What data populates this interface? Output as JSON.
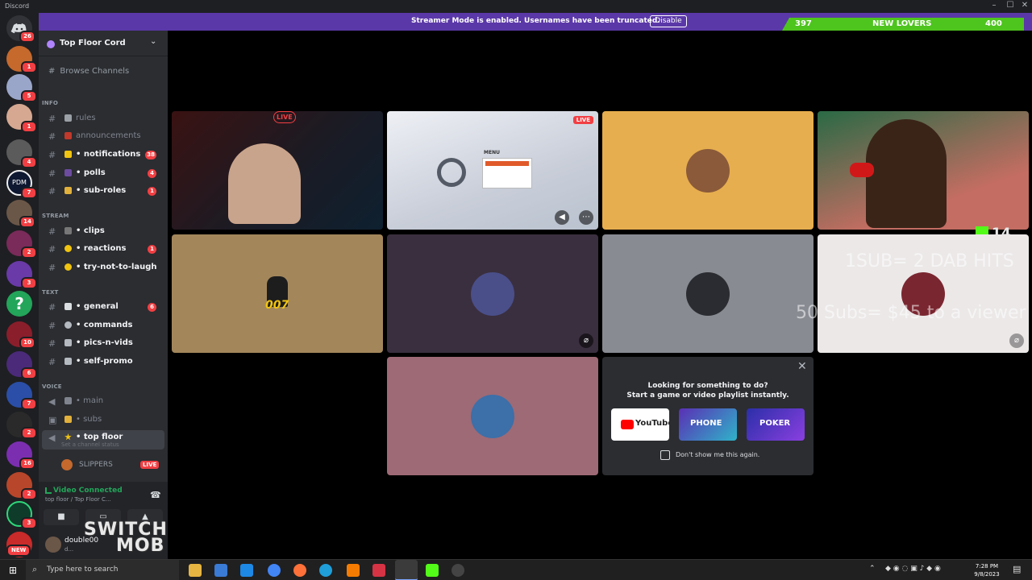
{
  "window": {
    "app_name": "Discord",
    "min": "–",
    "max": "☐",
    "close": "✕"
  },
  "banner": {
    "message": "Streamer Mode is enabled. Usernames have been truncated.",
    "button": "Disable",
    "goal_left": "397",
    "goal_label": "NEW LOVERS",
    "goal_right": "400"
  },
  "rail": {
    "home_badge": "26",
    "server_badges": [
      "1",
      "5",
      "1",
      "4",
      "7",
      "14",
      "2",
      "3",
      "10",
      "6",
      "7",
      "2",
      "16",
      "2",
      "3"
    ],
    "new_label": "NEW",
    "pdm_label": "PDM"
  },
  "sidebar": {
    "server_name": "Top Floor Cord",
    "browse": "Browse Channels",
    "categories": [
      "INFO",
      "STREAM",
      "TEXT",
      "VOICE"
    ],
    "channels": [
      {
        "name": "rules",
        "badge": ""
      },
      {
        "name": "announcements",
        "badge": ""
      },
      {
        "name": "• notifications",
        "badge": "38"
      },
      {
        "name": "• polls",
        "badge": "4"
      },
      {
        "name": "• sub-roles",
        "badge": "1"
      },
      {
        "name": "• clips",
        "badge": ""
      },
      {
        "name": "• reactions",
        "badge": "1"
      },
      {
        "name": "• try-not-to-laugh",
        "badge": ""
      },
      {
        "name": "• general",
        "badge": "6"
      },
      {
        "name": "• commands",
        "badge": ""
      },
      {
        "name": "• pics-n-vids",
        "badge": ""
      },
      {
        "name": "• self-promo",
        "badge": ""
      }
    ],
    "voice": [
      {
        "name": "• main"
      },
      {
        "name": "• subs"
      },
      {
        "name": "• top floor",
        "sub": "Set a channel status"
      }
    ],
    "voice_user": "SLIPPERS",
    "voice_user_live": "LIVE",
    "voice_connected": "Video Connected",
    "voice_location": "top floor / Top Floor C...",
    "username": "double00",
    "user_status": "d...",
    "watermark_line1": "SWITCH",
    "watermark_line2": "MOB"
  },
  "stage": {
    "live_tag": "LIVE",
    "game_menu_title": "MENU",
    "avatar_label_007": "007",
    "kick_count": "14",
    "overlay_line1": "1SUB= 2 DAB HITS",
    "overlay_line2": "50 Subs= $45 to a viewer"
  },
  "popup": {
    "title_line1": "Looking for something to do?",
    "title_line2": "Start a game or video playlist instantly.",
    "activities": [
      "YouTube",
      "PHONE",
      "POKER"
    ],
    "dont_show": "Don't show me this again."
  },
  "taskbar": {
    "search_placeholder": "Type here to search",
    "time": "7:28 PM",
    "date": "9/8/2023"
  },
  "colors": {
    "accent": "#5865f2",
    "banner": "#5b38a8",
    "goal": "#4ec41e",
    "danger": "#f23f43",
    "voice_green": "#23a55a"
  }
}
